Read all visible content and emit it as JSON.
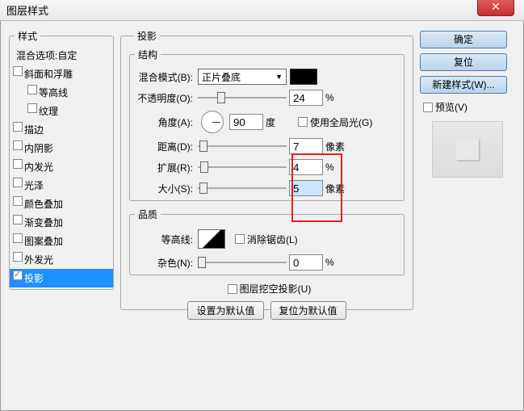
{
  "title": "图层样式",
  "close_icon": "✕",
  "left": {
    "legend": "样式",
    "items": [
      {
        "label": "混合选项:自定",
        "header": true
      },
      {
        "label": "斜面和浮雕",
        "chk": false
      },
      {
        "label": "等高线",
        "chk": false,
        "indent": true
      },
      {
        "label": "纹理",
        "chk": false,
        "indent": true
      },
      {
        "label": "描边",
        "chk": false
      },
      {
        "label": "内阴影",
        "chk": false
      },
      {
        "label": "内发光",
        "chk": false
      },
      {
        "label": "光泽",
        "chk": false
      },
      {
        "label": "颜色叠加",
        "chk": false
      },
      {
        "label": "渐变叠加",
        "chk": false
      },
      {
        "label": "图案叠加",
        "chk": false
      },
      {
        "label": "外发光",
        "chk": false
      },
      {
        "label": "投影",
        "chk": true,
        "selected": true
      }
    ]
  },
  "center": {
    "legend": "投影",
    "structure": {
      "legend": "结构",
      "blend_label": "混合模式(B):",
      "blend_value": "正片叠底",
      "opacity_label": "不透明度(O):",
      "opacity_value": "24",
      "opacity_unit": "%",
      "angle_label": "角度(A):",
      "angle_value": "90",
      "angle_unit": "度",
      "global_light": "使用全局光(G)",
      "distance_label": "距离(D):",
      "distance_value": "7",
      "distance_unit": "像素",
      "spread_label": "扩展(R):",
      "spread_value": "4",
      "spread_unit": "%",
      "size_label": "大小(S):",
      "size_value": "5",
      "size_unit": "像素"
    },
    "quality": {
      "legend": "品质",
      "contour_label": "等高线:",
      "antialias": "消除锯齿(L)",
      "noise_label": "杂色(N):",
      "noise_value": "0",
      "noise_unit": "%"
    },
    "knockout": "图层挖空投影(U)",
    "default_set": "设置为默认值",
    "default_reset": "复位为默认值"
  },
  "right": {
    "ok": "确定",
    "reset": "复位",
    "new_style": "新建样式(W)...",
    "preview_label": "预览(V)"
  }
}
